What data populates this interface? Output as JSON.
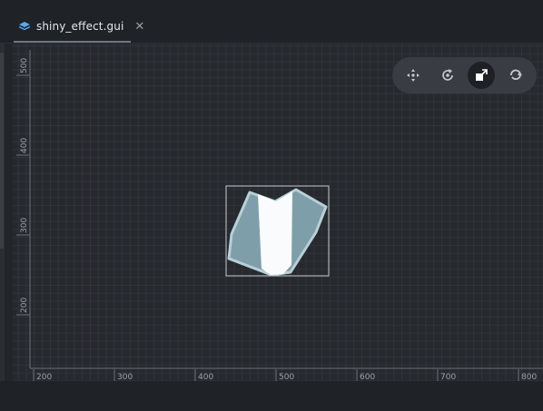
{
  "tab": {
    "label": "shiny_effect.gui",
    "close": "✕"
  },
  "toolbar": {
    "tools": [
      {
        "name": "move",
        "icon": "move-icon",
        "active": false
      },
      {
        "name": "rotate",
        "icon": "rotate-icon",
        "active": false
      },
      {
        "name": "scale",
        "icon": "scale-icon",
        "active": true
      },
      {
        "name": "reset",
        "icon": "reset-icon",
        "active": false
      }
    ]
  },
  "rulers": {
    "x_labels": [
      "200",
      "300",
      "400",
      "500",
      "600",
      "700",
      "800"
    ],
    "y_labels": [
      "500",
      "400",
      "300",
      "200"
    ]
  },
  "colors": {
    "accent": "#5aa9e6",
    "selection": "#c8ccd0"
  }
}
